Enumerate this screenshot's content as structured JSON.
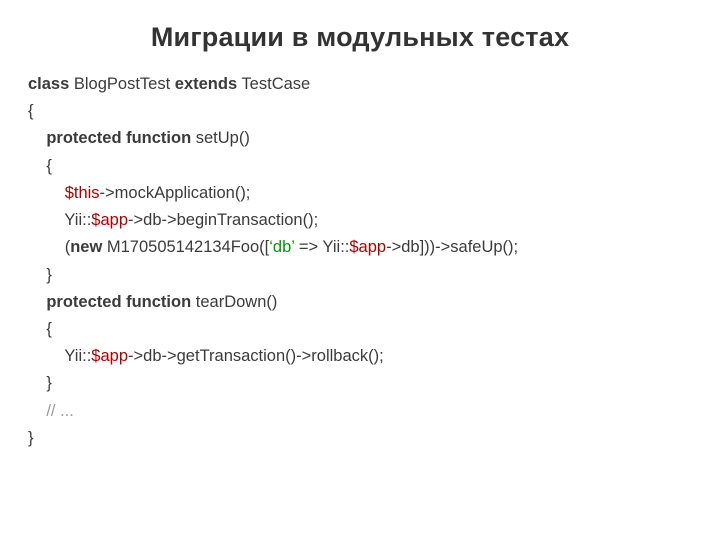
{
  "title": "Миграции в модульных тестах",
  "code": {
    "l1_kw1": "class",
    "l1_name": " BlogPostTest ",
    "l1_kw2": "extends",
    "l1_base": " TestCase",
    "l2": "{",
    "l3_kw": "protected function",
    "l3_name": " setUp()",
    "l4": "{",
    "l5_var": "$this",
    "l5_rest": "->mockApplication();",
    "l6_a": "Yii::",
    "l6_var": "$app",
    "l6_b": "->db->beginTransaction();",
    "l7_a": "(",
    "l7_kw": "new",
    "l7_b": " M170505142134Foo([",
    "l7_str": "‘db’",
    "l7_c": " => Yii::",
    "l7_var": "$app",
    "l7_d": "->db]))->safeUp();",
    "l8": "}",
    "l9": "",
    "l10_kw": "protected function",
    "l10_name": " tearDown()",
    "l11": "{",
    "l12_a": "Yii::",
    "l12_var": "$app",
    "l12_b": "->db->getTransaction()->rollback();",
    "l13": "}",
    "l14": "",
    "l15_cmt": "// ...",
    "l16": "}"
  }
}
